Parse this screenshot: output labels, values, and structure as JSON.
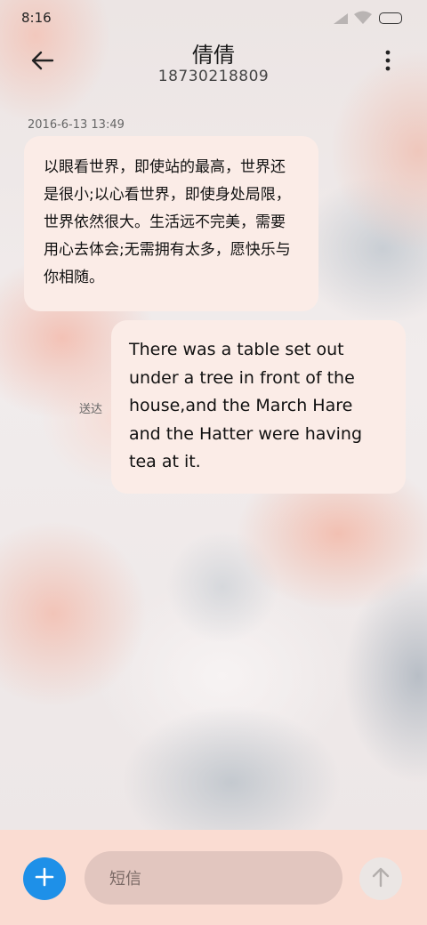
{
  "status_bar": {
    "time": "8:16"
  },
  "header": {
    "contact_name": "倩倩",
    "phone_number": "18730218809",
    "back_icon": "arrow-left-icon",
    "more_icon": "more-vertical-icon"
  },
  "conversation": {
    "timestamp": "2016-6-13 13:49",
    "received_message": "以眼看世界，即使站的最高，世界还是很小;以心看世界，即使身处局限，世界依然很大。生活远不完美，需要用心去体会;无需拥有太多，愿快乐与你相随。",
    "sent_message": "There was a table set out under a tree in front of the house,and the March Hare and the Hatter were having tea at it.",
    "sent_status": "送达"
  },
  "composer": {
    "placeholder": "短信",
    "add_icon": "plus-icon",
    "send_icon": "arrow-up-icon",
    "accent_color": "#1e90e8"
  }
}
